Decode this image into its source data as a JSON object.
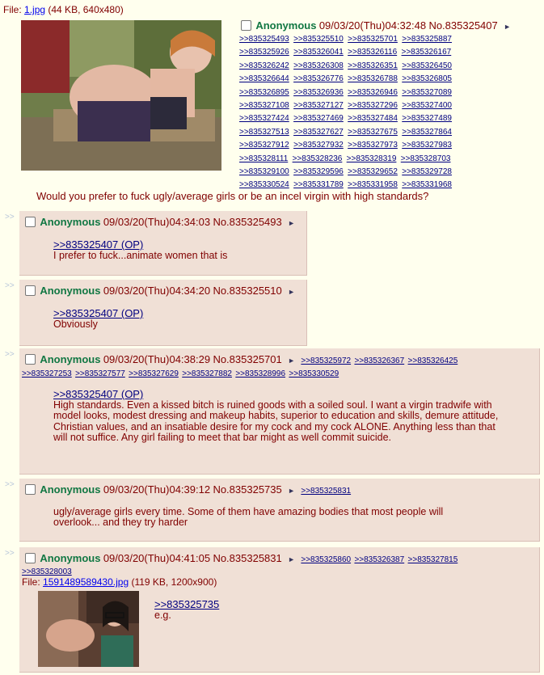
{
  "op": {
    "file_label": "File: ",
    "file_name": "1.jpg",
    "file_meta": " (44 KB, 640x480)",
    "name": "Anonymous",
    "datetime": "09/03/20(Thu)04:32:48",
    "post_no": "No.835325407",
    "backlinks": [
      ">>835325493",
      ">>835325510",
      ">>835325701",
      ">>835325887",
      ">>835325926",
      ">>835326041",
      ">>835326116",
      ">>835326167",
      ">>835326242",
      ">>835326308",
      ">>835326351",
      ">>835326450",
      ">>835326644",
      ">>835326776",
      ">>835326788",
      ">>835326805",
      ">>835326895",
      ">>835326936",
      ">>835326946",
      ">>835327089",
      ">>835327108",
      ">>835327127",
      ">>835327296",
      ">>835327400",
      ">>835327424",
      ">>835327469",
      ">>835327484",
      ">>835327489",
      ">>835327513",
      ">>835327627",
      ">>835327675",
      ">>835327864",
      ">>835327912",
      ">>835327932",
      ">>835327973",
      ">>835327983",
      ">>835328111",
      ">>835328236",
      ">>835328319",
      ">>835328703",
      ">>835329100",
      ">>835329596",
      ">>835329652",
      ">>835329728",
      ">>835330524",
      ">>835331789",
      ">>835331958",
      ">>835331968"
    ],
    "message": "Would you prefer to fuck ugly/average girls or be an incel virgin with high standards?"
  },
  "replies": [
    {
      "arrows": ">>",
      "name": "Anonymous",
      "datetime": "09/03/20(Thu)04:34:03",
      "post_no": "No.835325493",
      "quote": ">>835325407 (OP)",
      "text": "I prefer to fuck...animate women that is"
    },
    {
      "arrows": ">>",
      "name": "Anonymous",
      "datetime": "09/03/20(Thu)04:34:20",
      "post_no": "No.835325510",
      "quote": ">>835325407 (OP)",
      "text": "Obviously"
    },
    {
      "arrows": ">>",
      "name": "Anonymous",
      "datetime": "09/03/20(Thu)04:38:29",
      "post_no": "No.835325701",
      "backlinks_line1": [
        ">>835325972",
        ">>835326367",
        ">>835326425"
      ],
      "backlinks_line2": [
        ">>835327253",
        ">>835327577",
        ">>835327629",
        ">>835327882",
        ">>835328996",
        ">>835330529"
      ],
      "quote": ">>835325407 (OP)",
      "text": "High standards. Even a kissed bitch is ruined goods with a soiled soul. I want a virgin tradwife with model looks, modest dressing and makeup habits, superior to education and skills, demure attitude, Christian values, and an insatiable desire for my cock and my cock ALONE. Anything less than that will not suffice. Any girl failing to meet that bar might as well commit suicide."
    },
    {
      "arrows": ">>",
      "name": "Anonymous",
      "datetime": "09/03/20(Thu)04:39:12",
      "post_no": "No.835325735",
      "backlinks_line1": [
        ">>835325831"
      ],
      "text": "ugly/average girls every time. Some of them have amazing bodies that most people will overlook... and they try harder"
    },
    {
      "arrows": ">>",
      "name": "Anonymous",
      "datetime": "09/03/20(Thu)04:41:05",
      "post_no": "No.835325831",
      "backlinks_line1": [
        ">>835325860",
        ">>835326387",
        ">>835327815"
      ],
      "backlinks_line2": [
        ">>835328003"
      ],
      "file_label": "File: ",
      "file_name": "1591489589430.jpg",
      "file_meta": " (119 KB, 1200x900)",
      "quote": ">>835325735",
      "text": "e.g."
    }
  ],
  "colors": {
    "background": "#ffffee",
    "reply_bg": "#f0e0d6",
    "name": "#117743",
    "text": "#800000",
    "link": "#000080"
  }
}
